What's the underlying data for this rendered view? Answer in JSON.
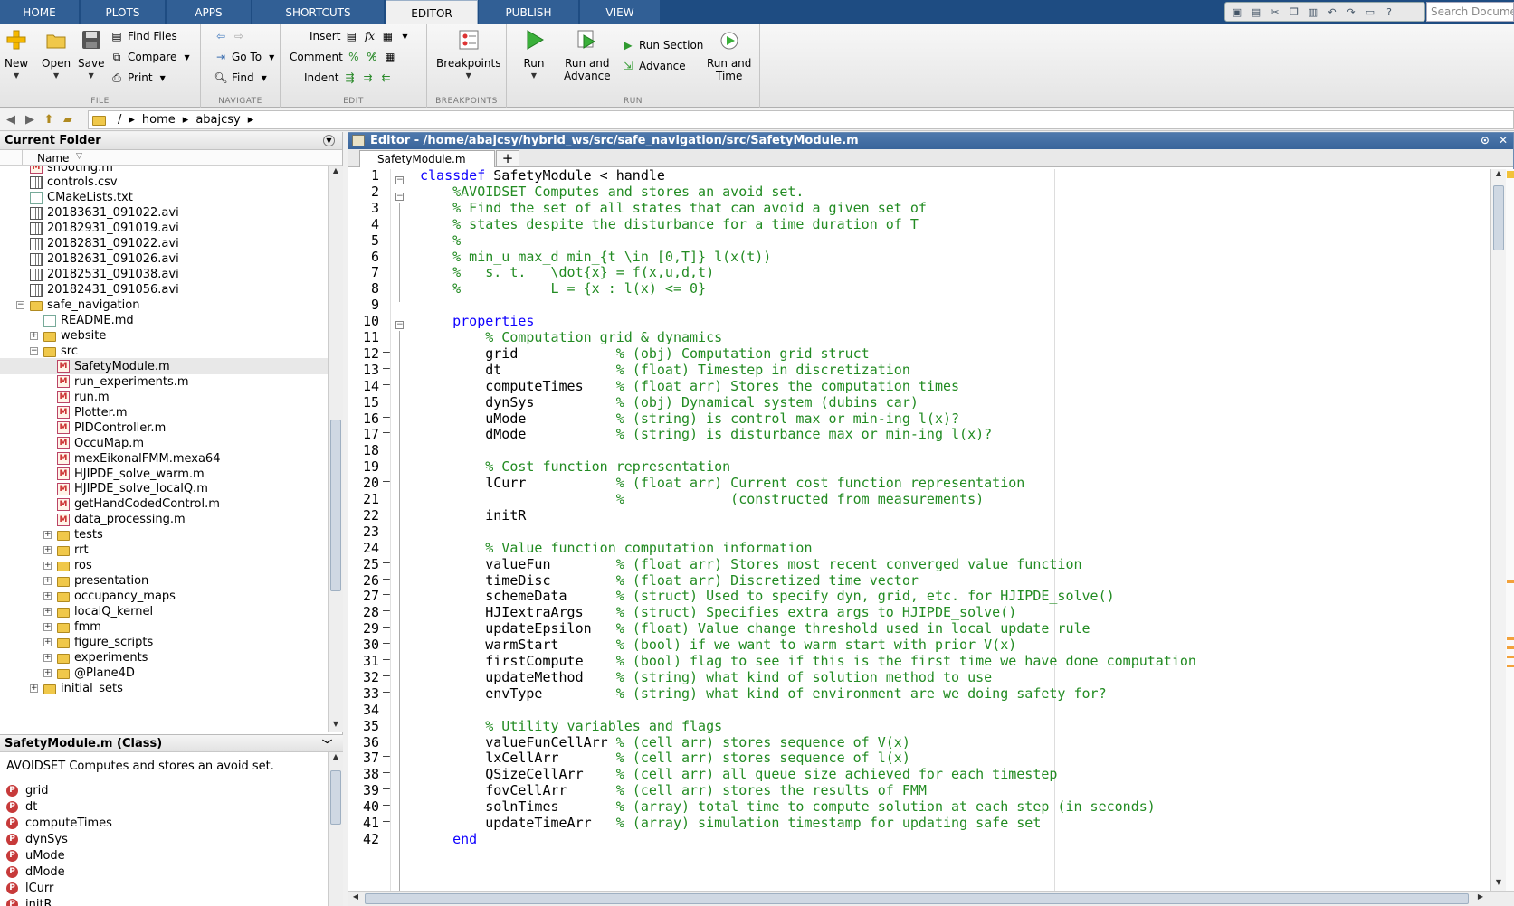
{
  "tabs": [
    "HOME",
    "PLOTS",
    "APPS",
    "SHORTCUTS",
    "EDITOR",
    "PUBLISH",
    "VIEW"
  ],
  "search_placeholder": "Search Documentation",
  "ribbon": {
    "file": {
      "new": "New",
      "open": "Open",
      "save": "Save",
      "find_files": "Find Files",
      "compare": "Compare",
      "print": "Print",
      "label": "FILE"
    },
    "navigate": {
      "goto": "Go To",
      "find": "Find",
      "label": "NAVIGATE"
    },
    "edit": {
      "insert": "Insert",
      "comment": "Comment",
      "indent": "Indent",
      "fx": "fx",
      "label": "EDIT"
    },
    "breakpoints": {
      "btn": "Breakpoints",
      "label": "BREAKPOINTS"
    },
    "run": {
      "run": "Run",
      "run_advance_1": "Run and",
      "run_advance_2": "Advance",
      "run_section": "Run Section",
      "advance": "Advance",
      "run_time_1": "Run and",
      "run_time_2": "Time",
      "label": "RUN"
    }
  },
  "path": [
    "/",
    "home",
    "abajcsy"
  ],
  "current_folder": {
    "title": "Current Folder",
    "col_name": "Name",
    "items": [
      {
        "name": "shooting.m",
        "type": "m",
        "indent": 2,
        "exp": ""
      },
      {
        "name": "controls.csv",
        "type": "avi",
        "indent": 2,
        "exp": ""
      },
      {
        "name": "CMakeLists.txt",
        "type": "txt",
        "indent": 2,
        "exp": ""
      },
      {
        "name": "20183631_091022.avi",
        "type": "avi",
        "indent": 2,
        "exp": ""
      },
      {
        "name": "20182931_091019.avi",
        "type": "avi",
        "indent": 2,
        "exp": ""
      },
      {
        "name": "20182831_091022.avi",
        "type": "avi",
        "indent": 2,
        "exp": ""
      },
      {
        "name": "20182631_091026.avi",
        "type": "avi",
        "indent": 2,
        "exp": ""
      },
      {
        "name": "20182531_091038.avi",
        "type": "avi",
        "indent": 2,
        "exp": ""
      },
      {
        "name": "20182431_091056.avi",
        "type": "avi",
        "indent": 2,
        "exp": ""
      },
      {
        "name": "safe_navigation",
        "type": "folder",
        "indent": 1,
        "exp": "−"
      },
      {
        "name": "README.md",
        "type": "txt",
        "indent": 3,
        "exp": ""
      },
      {
        "name": "website",
        "type": "folder",
        "indent": 2,
        "exp": "+"
      },
      {
        "name": "src",
        "type": "folder",
        "indent": 2,
        "exp": "−"
      },
      {
        "name": "SafetyModule.m",
        "type": "m",
        "indent": 4,
        "exp": "",
        "selected": true
      },
      {
        "name": "run_experiments.m",
        "type": "m",
        "indent": 4,
        "exp": ""
      },
      {
        "name": "run.m",
        "type": "m",
        "indent": 4,
        "exp": ""
      },
      {
        "name": "Plotter.m",
        "type": "m",
        "indent": 4,
        "exp": ""
      },
      {
        "name": "PIDController.m",
        "type": "m",
        "indent": 4,
        "exp": ""
      },
      {
        "name": "OccuMap.m",
        "type": "m",
        "indent": 4,
        "exp": ""
      },
      {
        "name": "mexEikonalFMM.mexa64",
        "type": "m",
        "indent": 4,
        "exp": ""
      },
      {
        "name": "HJIPDE_solve_warm.m",
        "type": "m",
        "indent": 4,
        "exp": ""
      },
      {
        "name": "HJIPDE_solve_localQ.m",
        "type": "m",
        "indent": 4,
        "exp": ""
      },
      {
        "name": "getHandCodedControl.m",
        "type": "m",
        "indent": 4,
        "exp": ""
      },
      {
        "name": "data_processing.m",
        "type": "m",
        "indent": 4,
        "exp": ""
      },
      {
        "name": "tests",
        "type": "folder",
        "indent": 3,
        "exp": "+"
      },
      {
        "name": "rrt",
        "type": "folder",
        "indent": 3,
        "exp": "+"
      },
      {
        "name": "ros",
        "type": "folder",
        "indent": 3,
        "exp": "+"
      },
      {
        "name": "presentation",
        "type": "folder",
        "indent": 3,
        "exp": "+"
      },
      {
        "name": "occupancy_maps",
        "type": "folder",
        "indent": 3,
        "exp": "+"
      },
      {
        "name": "localQ_kernel",
        "type": "folder",
        "indent": 3,
        "exp": "+"
      },
      {
        "name": "fmm",
        "type": "folder",
        "indent": 3,
        "exp": "+"
      },
      {
        "name": "figure_scripts",
        "type": "folder",
        "indent": 3,
        "exp": "+"
      },
      {
        "name": "experiments",
        "type": "folder",
        "indent": 3,
        "exp": "+"
      },
      {
        "name": "@Plane4D",
        "type": "folder",
        "indent": 3,
        "exp": "+"
      },
      {
        "name": "initial_sets",
        "type": "folder",
        "indent": 2,
        "exp": "+"
      }
    ]
  },
  "details": {
    "title": "SafetyModule.m  (Class)",
    "description": "AVOIDSET Computes and stores an avoid set.",
    "properties": [
      "grid",
      "dt",
      "computeTimes",
      "dynSys",
      "uMode",
      "dMode",
      "lCurr",
      "initR"
    ]
  },
  "editor": {
    "title": "Editor - /home/abajcsy/hybrid_ws/src/safe_navigation/src/SafetyModule.m",
    "tab": "SafetyModule.m",
    "lines": [
      {
        "n": 1,
        "code": "",
        "kw": "classdef",
        "rest": " SafetyModule < handle",
        "cm": ""
      },
      {
        "n": 2,
        "code": "    ",
        "kw": "",
        "rest": "",
        "cm": "%AVOIDSET Computes and stores an avoid set."
      },
      {
        "n": 3,
        "code": "    ",
        "kw": "",
        "rest": "",
        "cm": "% Find the set of all states that can avoid a given set of"
      },
      {
        "n": 4,
        "code": "    ",
        "kw": "",
        "rest": "",
        "cm": "% states despite the disturbance for a time duration of T"
      },
      {
        "n": 5,
        "code": "    ",
        "kw": "",
        "rest": "",
        "cm": "%"
      },
      {
        "n": 6,
        "code": "    ",
        "kw": "",
        "rest": "",
        "cm": "% min_u max_d min_{t \\in [0,T]} l(x(t))"
      },
      {
        "n": 7,
        "code": "    ",
        "kw": "",
        "rest": "",
        "cm": "%   s. t.   \\dot{x} = f(x,u,d,t)"
      },
      {
        "n": 8,
        "code": "    ",
        "kw": "",
        "rest": "",
        "cm": "%           L = {x : l(x) <= 0}"
      },
      {
        "n": 9,
        "code": "",
        "kw": "",
        "rest": "",
        "cm": ""
      },
      {
        "n": 10,
        "code": "    ",
        "kw": "properties",
        "rest": "",
        "cm": ""
      },
      {
        "n": 11,
        "code": "        ",
        "kw": "",
        "rest": "",
        "cm": "% Computation grid & dynamics"
      },
      {
        "n": 12,
        "code": "        grid            ",
        "kw": "",
        "rest": "",
        "cm": "% (obj) Computation grid struct"
      },
      {
        "n": 13,
        "code": "        dt              ",
        "kw": "",
        "rest": "",
        "cm": "% (float) Timestep in discretization"
      },
      {
        "n": 14,
        "code": "        computeTimes    ",
        "kw": "",
        "rest": "",
        "cm": "% (float arr) Stores the computation times"
      },
      {
        "n": 15,
        "code": "        dynSys          ",
        "kw": "",
        "rest": "",
        "cm": "% (obj) Dynamical system (dubins car)"
      },
      {
        "n": 16,
        "code": "        uMode           ",
        "kw": "",
        "rest": "",
        "cm": "% (string) is control max or min-ing l(x)?"
      },
      {
        "n": 17,
        "code": "        dMode           ",
        "kw": "",
        "rest": "",
        "cm": "% (string) is disturbance max or min-ing l(x)?"
      },
      {
        "n": 18,
        "code": "",
        "kw": "",
        "rest": "",
        "cm": ""
      },
      {
        "n": 19,
        "code": "        ",
        "kw": "",
        "rest": "",
        "cm": "% Cost function representation"
      },
      {
        "n": 20,
        "code": "        lCurr           ",
        "kw": "",
        "rest": "",
        "cm": "% (float arr) Current cost function representation"
      },
      {
        "n": 21,
        "code": "                        ",
        "kw": "",
        "rest": "",
        "cm": "%             (constructed from measurements)"
      },
      {
        "n": 22,
        "code": "        initR",
        "kw": "",
        "rest": "",
        "cm": ""
      },
      {
        "n": 23,
        "code": "",
        "kw": "",
        "rest": "",
        "cm": ""
      },
      {
        "n": 24,
        "code": "        ",
        "kw": "",
        "rest": "",
        "cm": "% Value function computation information"
      },
      {
        "n": 25,
        "code": "        valueFun        ",
        "kw": "",
        "rest": "",
        "cm": "% (float arr) Stores most recent converged value function"
      },
      {
        "n": 26,
        "code": "        timeDisc        ",
        "kw": "",
        "rest": "",
        "cm": "% (float arr) Discretized time vector"
      },
      {
        "n": 27,
        "code": "        schemeData      ",
        "kw": "",
        "rest": "",
        "cm": "% (struct) Used to specify dyn, grid, etc. for HJIPDE_solve()"
      },
      {
        "n": 28,
        "code": "        HJIextraArgs    ",
        "kw": "",
        "rest": "",
        "cm": "% (struct) Specifies extra args to HJIPDE_solve()"
      },
      {
        "n": 29,
        "code": "        updateEpsilon   ",
        "kw": "",
        "rest": "",
        "cm": "% (float) Value change threshold used in local update rule"
      },
      {
        "n": 30,
        "code": "        warmStart       ",
        "kw": "",
        "rest": "",
        "cm": "% (bool) if we want to warm start with prior V(x)"
      },
      {
        "n": 31,
        "code": "        firstCompute    ",
        "kw": "",
        "rest": "",
        "cm": "% (bool) flag to see if this is the first time we have done computation"
      },
      {
        "n": 32,
        "code": "        updateMethod    ",
        "kw": "",
        "rest": "",
        "cm": "% (string) what kind of solution method to use"
      },
      {
        "n": 33,
        "code": "        envType         ",
        "kw": "",
        "rest": "",
        "cm": "% (string) what kind of environment are we doing safety for?"
      },
      {
        "n": 34,
        "code": "",
        "kw": "",
        "rest": "",
        "cm": ""
      },
      {
        "n": 35,
        "code": "        ",
        "kw": "",
        "rest": "",
        "cm": "% Utility variables and flags"
      },
      {
        "n": 36,
        "code": "        valueFunCellArr ",
        "kw": "",
        "rest": "",
        "cm": "% (cell arr) stores sequence of V(x)"
      },
      {
        "n": 37,
        "code": "        lxCellArr       ",
        "kw": "",
        "rest": "",
        "cm": "% (cell arr) stores sequence of l(x)"
      },
      {
        "n": 38,
        "code": "        QSizeCellArr    ",
        "kw": "",
        "rest": "",
        "cm": "% (cell arr) all queue size achieved for each timestep"
      },
      {
        "n": 39,
        "code": "        fovCellArr      ",
        "kw": "",
        "rest": "",
        "cm": "% (cell arr) stores the results of FMM"
      },
      {
        "n": 40,
        "code": "        solnTimes       ",
        "kw": "",
        "rest": "",
        "cm": "% (array) total time to compute solution at each step (in seconds)"
      },
      {
        "n": 41,
        "code": "        updateTimeArr   ",
        "kw": "",
        "rest": "",
        "cm": "% (array) simulation timestamp for updating safe set"
      },
      {
        "n": 42,
        "code": "    ",
        "kw": "end",
        "rest": "",
        "cm": ""
      }
    ],
    "dash_lines": [
      12,
      13,
      14,
      15,
      16,
      17,
      20,
      22,
      25,
      26,
      27,
      28,
      29,
      30,
      31,
      32,
      33,
      36,
      37,
      38,
      39,
      40,
      41
    ]
  },
  "colors": {
    "keyword": "#0e00ff",
    "comment": "#228b22",
    "tabstrip": "#1e4c82"
  }
}
